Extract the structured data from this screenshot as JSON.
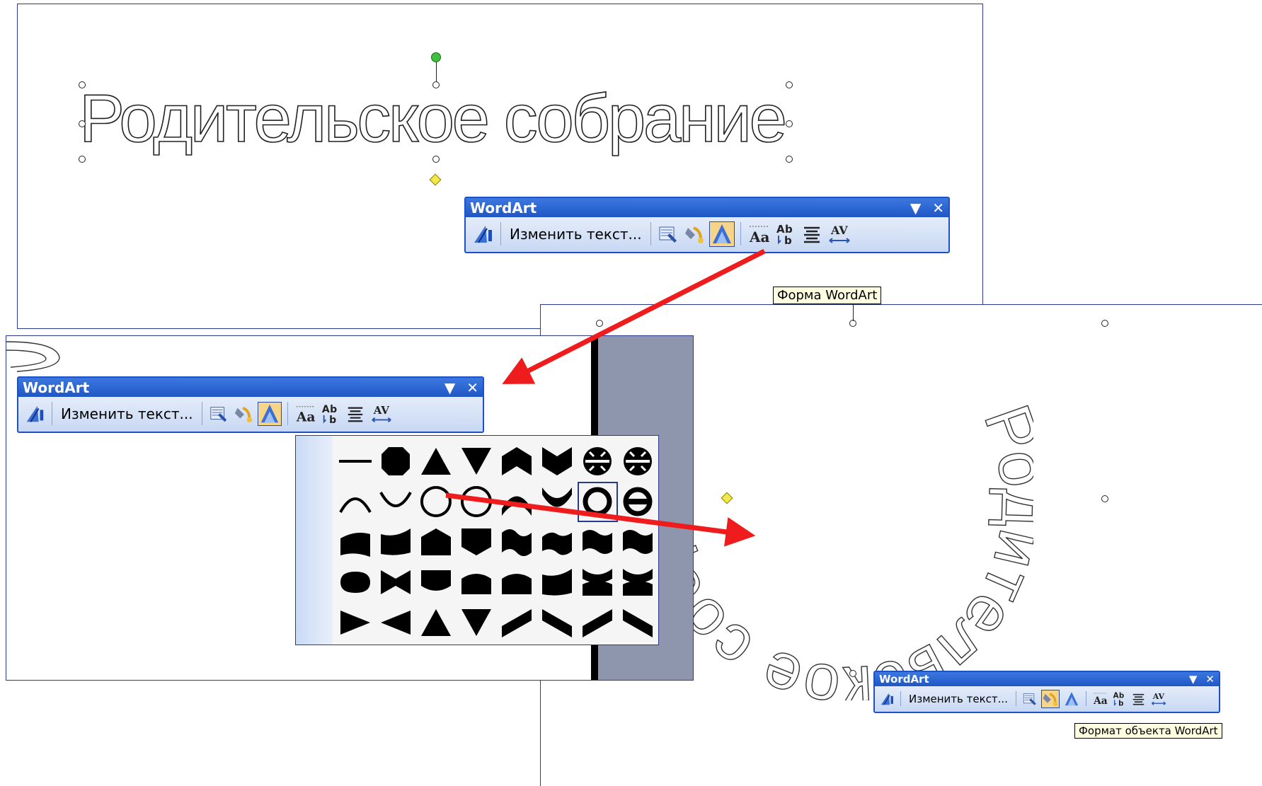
{
  "wordart_title": "Родительское собрание",
  "wordart_arched_text": "Родительское собрание",
  "toolbars": [
    {
      "id": "top",
      "title": "WordArt",
      "edit_label": "Изменить текст...",
      "active_tool": "shape-icon"
    },
    {
      "id": "left",
      "title": "WordArt",
      "edit_label": "Изменить текст...",
      "active_tool": "shape-icon"
    },
    {
      "id": "bottom",
      "title": "WordArt",
      "edit_label": "Изменить текст...",
      "active_tool": "format-icon"
    }
  ],
  "toolbar_icons": [
    "wordart-insert-icon",
    "gallery-icon",
    "format-icon",
    "shape-icon",
    "same-height-icon",
    "vertical-text-icon",
    "align-icon",
    "spacing-icon"
  ],
  "tooltips": {
    "shape": "Форма WordArt",
    "format": "Формат объекта WordArt"
  },
  "shape_gallery": {
    "rows": 5,
    "cols": 8,
    "selected": {
      "row": 2,
      "col": 7
    }
  },
  "colors": {
    "toolbar_title": "#1f57c6",
    "arrow": "#ee1c1c",
    "frame": "#2b3a8f",
    "scroll_gray": "#8e96ad"
  }
}
